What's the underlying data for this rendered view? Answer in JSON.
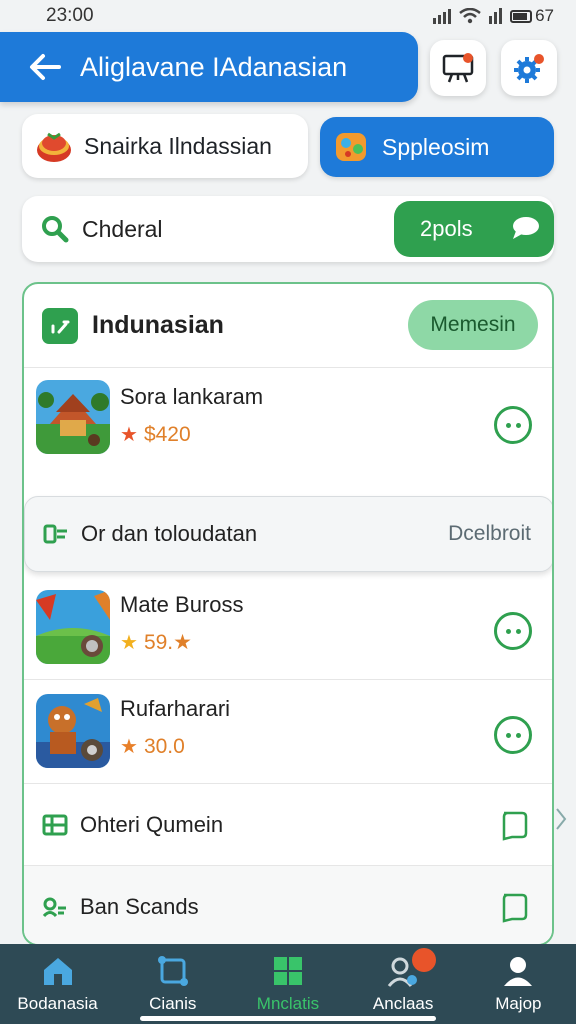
{
  "status_bar": {
    "time": "23:00",
    "battery": "67"
  },
  "header": {
    "title": "Aliglavane IAdanasian"
  },
  "tabs": {
    "left_label": "Snairka Ilndassian",
    "right_label": "Sppleosim"
  },
  "search": {
    "value": "Chderal",
    "button_label": "2pols"
  },
  "card": {
    "title": "Indunasian",
    "badge_label": "Memesin",
    "games": [
      {
        "name": "Sora lankaram",
        "rating": "$420"
      },
      {
        "name": "Mate Buross",
        "rating": "59.★"
      },
      {
        "name": "Rufarharari",
        "rating": "30.0"
      }
    ],
    "options": [
      {
        "label": "Or dan toloudatan",
        "right_text": "Dcelbroit"
      },
      {
        "label": "Ohteri Qumein"
      },
      {
        "label": "Ban Scands"
      }
    ]
  },
  "bottom_nav": {
    "items": [
      {
        "label": "Bodanasia"
      },
      {
        "label": "Cianis"
      },
      {
        "label": "Mnclatis"
      },
      {
        "label": "Anclaas"
      },
      {
        "label": "Majop"
      }
    ]
  },
  "colors": {
    "accent_blue": "#1e7ad9",
    "accent_green": "#2fa04f",
    "nav_bg": "#2e4a55",
    "badge_orange": "#e8542a"
  }
}
